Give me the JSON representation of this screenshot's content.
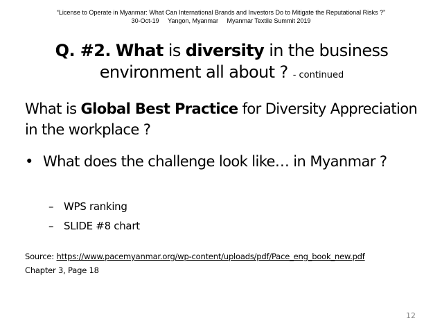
{
  "header": {
    "line1": "“License to Operate in Myanmar: What Can International Brands and Investors Do to Mitigate the Reputational Risks ?”",
    "date": "30-Oct-19",
    "location": "Yangon, Myanmar",
    "event": "Myanmar Textile Summit 2019"
  },
  "title": {
    "q": "Q. #2.",
    "what": "What",
    "is": "is",
    "diversity": "diversity",
    "rest1": "in the business",
    "line2": "environment all about ?",
    "suffix": "- continued"
  },
  "body": {
    "what_is": "What is",
    "gbp": "Global Best Practice",
    "rest": "for Diversity Appreciation in the workplace ?"
  },
  "bullet": {
    "symbol": "•",
    "text": "What does the challenge look like… in Myanmar ?"
  },
  "subitems": [
    {
      "dash": "–",
      "text": "WPS ranking"
    },
    {
      "dash": "–",
      "text": "SLIDE #8 chart"
    }
  ],
  "source": {
    "label": "Source:",
    "url": "https://www.pacemyanmar.org/wp-content/uploads/pdf/Pace_eng_book_new.pdf",
    "chapter": "Chapter 3, Page 18"
  },
  "page_number": "12"
}
